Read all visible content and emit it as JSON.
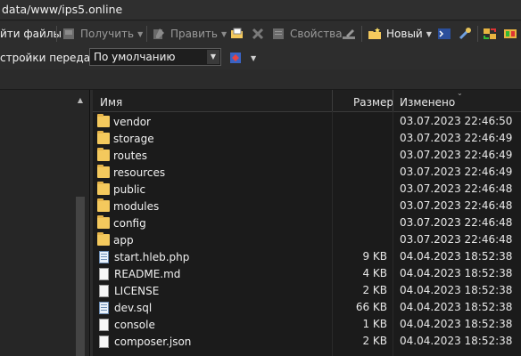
{
  "path": "data/www/ips5.online",
  "toolbar": {
    "upload_label": "йти файлы",
    "download_label": "Получить",
    "edit_label": "Править",
    "properties_label": "Свойства",
    "new_label": "Новый"
  },
  "transfer": {
    "label": "стройки передачи",
    "selected": "По умолчанию"
  },
  "columns": {
    "name": "Имя",
    "size": "Размер",
    "modified": "Изменено"
  },
  "files": [
    {
      "name": "vendor",
      "type": "folder",
      "size": "",
      "modified": "03.07.2023 22:46:50"
    },
    {
      "name": "storage",
      "type": "folder",
      "size": "",
      "modified": "03.07.2023 22:46:49"
    },
    {
      "name": "routes",
      "type": "folder",
      "size": "",
      "modified": "03.07.2023 22:46:49"
    },
    {
      "name": "resources",
      "type": "folder",
      "size": "",
      "modified": "03.07.2023 22:46:49"
    },
    {
      "name": "public",
      "type": "folder",
      "size": "",
      "modified": "03.07.2023 22:46:48"
    },
    {
      "name": "modules",
      "type": "folder",
      "size": "",
      "modified": "03.07.2023 22:46:48"
    },
    {
      "name": "config",
      "type": "folder",
      "size": "",
      "modified": "03.07.2023 22:46:48"
    },
    {
      "name": "app",
      "type": "folder",
      "size": "",
      "modified": "03.07.2023 22:46:48"
    },
    {
      "name": "start.hleb.php",
      "type": "notes",
      "size": "9 KB",
      "modified": "04.04.2023 18:52:38"
    },
    {
      "name": "README.md",
      "type": "file",
      "size": "4 KB",
      "modified": "04.04.2023 18:52:38"
    },
    {
      "name": "LICENSE",
      "type": "file",
      "size": "2 KB",
      "modified": "04.04.2023 18:52:38"
    },
    {
      "name": "dev.sql",
      "type": "notes",
      "size": "66 KB",
      "modified": "04.04.2023 18:52:38"
    },
    {
      "name": "console",
      "type": "file",
      "size": "1 KB",
      "modified": "04.04.2023 18:52:38"
    },
    {
      "name": "composer.json",
      "type": "file",
      "size": "2 KB",
      "modified": "04.04.2023 18:52:38"
    }
  ]
}
